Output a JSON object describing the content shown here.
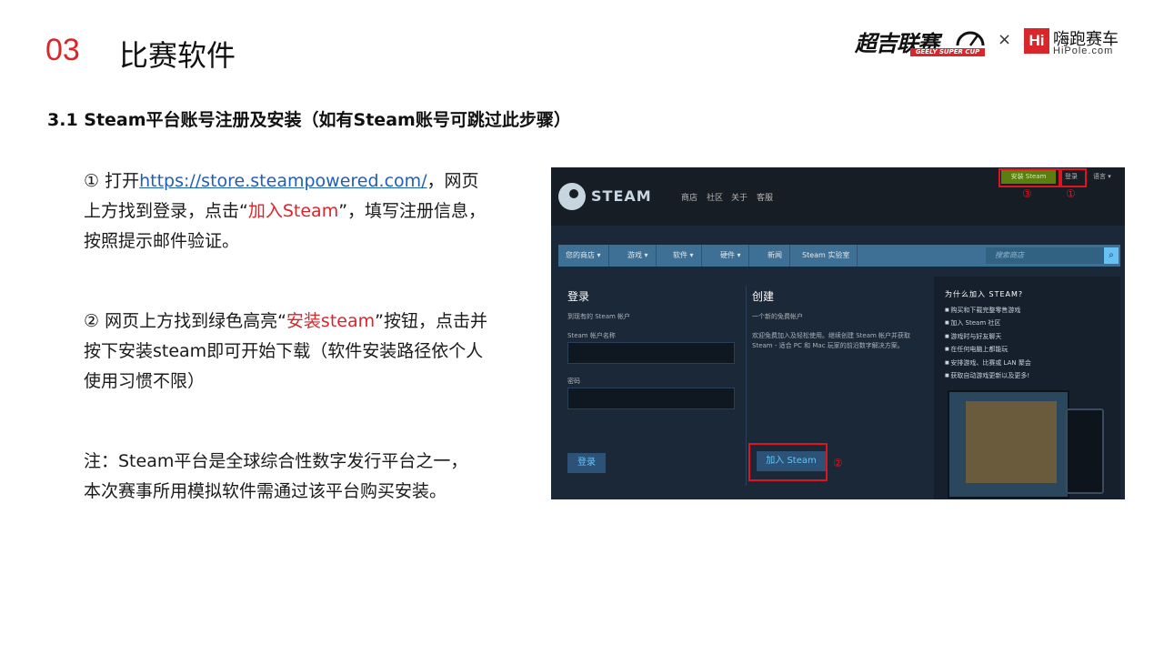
{
  "header": {
    "section_number": "03",
    "section_title": "比赛软件",
    "logo_cup_cn": "超吉联赛",
    "logo_cup_en": "GEELY SUPER CUP",
    "logo_sep": "×",
    "logo_hipole_icon": "Hi",
    "logo_hipole_cn": "嗨跑赛车",
    "logo_hipole_en": "HiPole.com"
  },
  "subtitle": "3.1   Steam平台账号注册及安装（如有Steam账号可跳过此步骤）",
  "step1": {
    "prefix": "① 打开",
    "link": "https://store.steampowered.com/",
    "mid": "，网页上方找到登录，点击“",
    "highlight": "加入Steam",
    "suffix": "”，填写注册信息，按照提示邮件验证。"
  },
  "step2": {
    "prefix": "② 网页上方找到绿色高亮“",
    "highlight": "安装steam",
    "suffix": "”按钮，点击并按下安装steam即可开始下载（软件安装路径依个人使用习惯不限）"
  },
  "note": "注：Steam平台是全球综合性数字发行平台之一，本次赛事所用模拟软件需通过该平台购买安装。",
  "steam": {
    "logo_text": "STEAM",
    "nav": [
      "商店",
      "社区",
      "关于",
      "客服"
    ],
    "install_label": "安装 Steam",
    "login_top": "登录",
    "language": "语言 ▾",
    "markers": [
      "③",
      "①",
      "②"
    ],
    "menu": [
      "您的商店 ▾",
      "游戏 ▾",
      "软件 ▾",
      "硬件 ▾",
      "新闻",
      "Steam 实验室"
    ],
    "search_placeholder": "搜索商店",
    "login_title": "登录",
    "login_sub": "到现有的 Steam 帐户",
    "username_label": "Steam 帐户名称",
    "password_label": "密码",
    "login_button": "登录",
    "create_title": "创建",
    "create_sub": "一个新的免费帐户",
    "create_desc": "欢迎免费加入及轻松使用。继续创建 Steam 帐户并获取 Steam - 适合 PC 和 Mac 玩家的前沿数字解决方案。",
    "join_button": "加入 Steam",
    "why_title": "为什么加入 STEAM?",
    "why_list": [
      "购买和下载完整零售游戏",
      "加入 Steam 社区",
      "游戏时与好友聊天",
      "在任何电脑上都能玩",
      "安排游戏、比赛或 LAN 聚会",
      "获取自动游戏更新以及更多!"
    ]
  }
}
